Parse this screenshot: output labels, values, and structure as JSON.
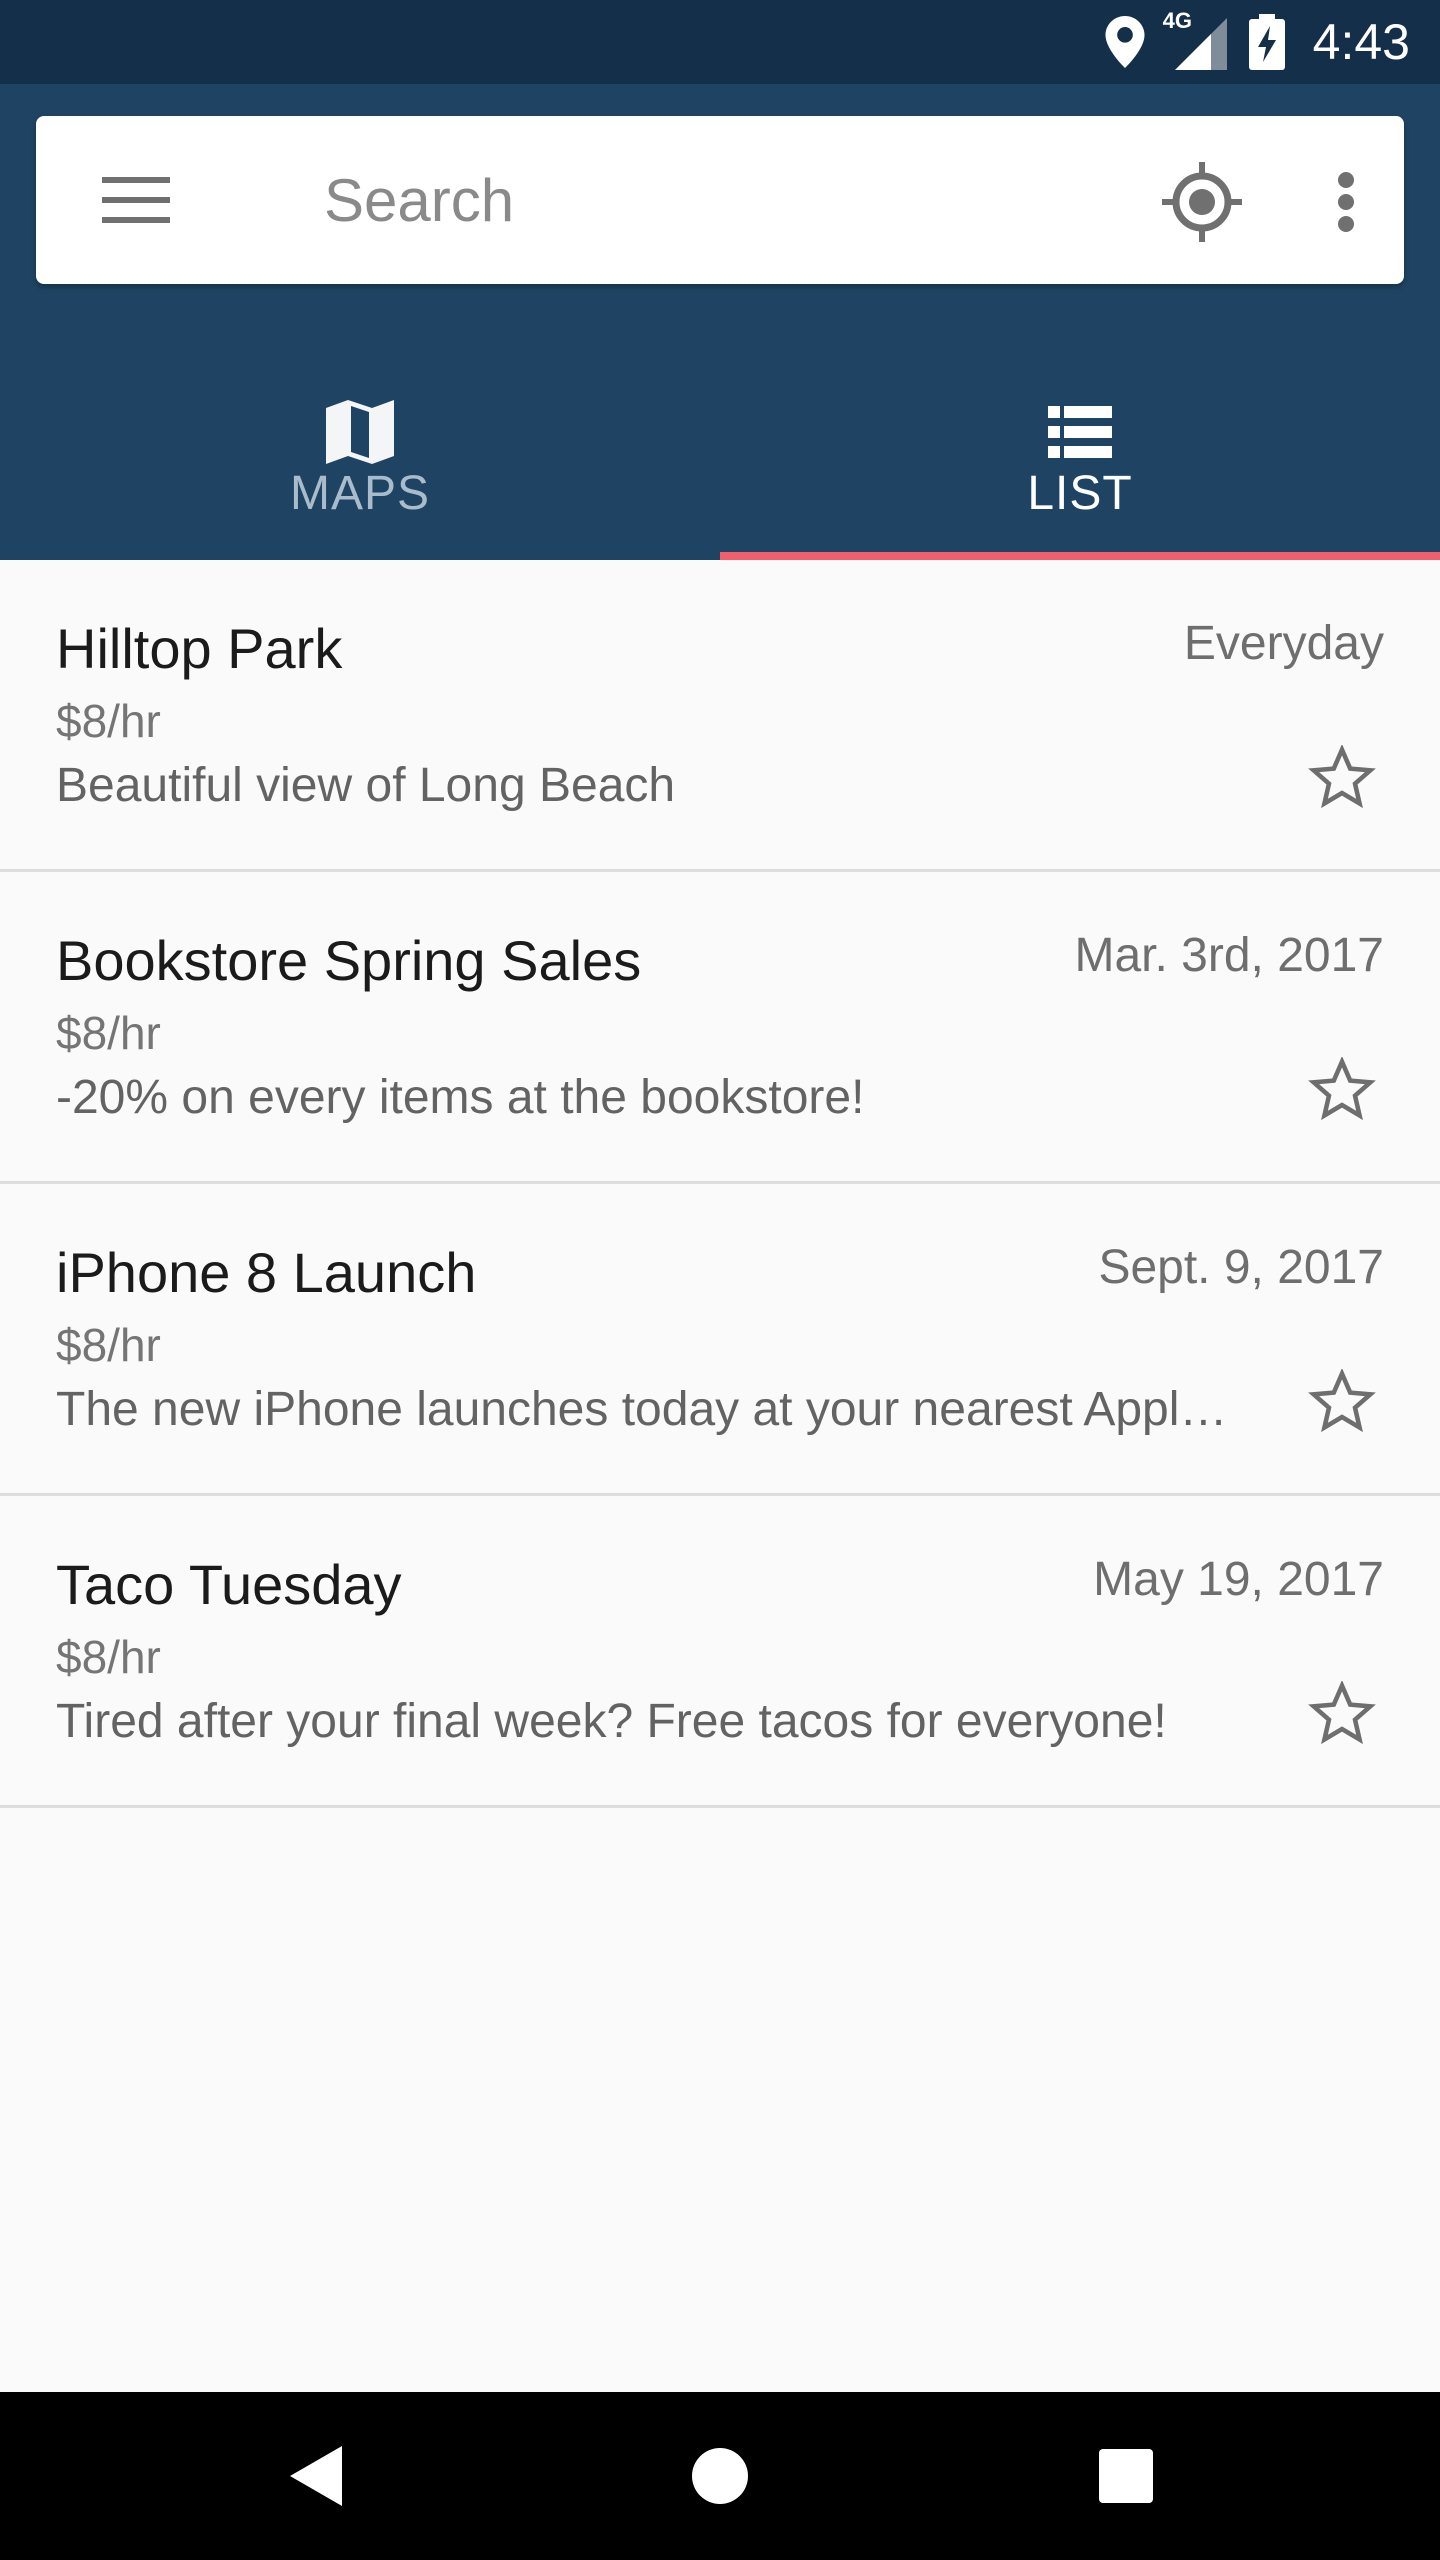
{
  "status_bar": {
    "time": "4:43",
    "network": "4G",
    "icons": [
      "location-icon",
      "signal-icon",
      "battery-charging-icon"
    ],
    "background": "#142f49"
  },
  "search": {
    "placeholder": "Search",
    "menu_icon": "hamburger-menu-icon",
    "locate_icon": "my-location-icon",
    "more_icon": "more-vert-icon"
  },
  "tabs": [
    {
      "label": "MAPS",
      "icon": "map-icon",
      "selected": false
    },
    {
      "label": "LIST",
      "icon": "list-icon",
      "selected": true
    }
  ],
  "colors": {
    "header": "#1f4463",
    "tab_indicator": "#ef5f6d",
    "background": "#fafafa"
  },
  "items": [
    {
      "title": "Hilltop Park",
      "date": "Everyday",
      "price": "$8/hr",
      "description": "Beautiful view of Long Beach",
      "starred": false
    },
    {
      "title": "Bookstore Spring Sales",
      "date": "Mar. 3rd, 2017",
      "price": "$8/hr",
      "description": "-20% on every items at the bookstore!",
      "starred": false
    },
    {
      "title": "iPhone 8 Launch",
      "date": "Sept. 9, 2017",
      "price": "$8/hr",
      "description": "The new iPhone launches today at your nearest Appl…",
      "starred": false
    },
    {
      "title": "Taco Tuesday",
      "date": "May 19, 2017",
      "price": "$8/hr",
      "description": "Tired after your final week? Free tacos for everyone!",
      "starred": false
    }
  ],
  "nav_bar": {
    "icons": [
      "back-icon",
      "home-icon",
      "recents-icon"
    ]
  }
}
